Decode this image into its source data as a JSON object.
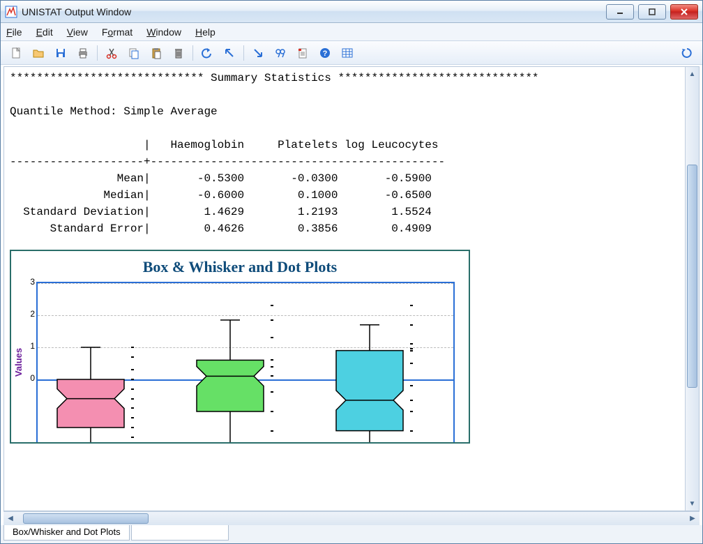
{
  "title": "UNISTAT Output Window",
  "menus": {
    "file": "File",
    "edit": "Edit",
    "view": "View",
    "format": "Format",
    "window": "Window",
    "help": "Help"
  },
  "toolbar_icons": [
    "new-file",
    "open-file",
    "save-file",
    "print",
    "cut",
    "copy",
    "paste",
    "delete",
    "undo",
    "nw-arrow",
    "se-arrow",
    "find",
    "properties",
    "help",
    "table",
    "refresh"
  ],
  "output": {
    "banner_left": "*****************************",
    "banner_title": " Summary Statistics ",
    "banner_right": "******************************",
    "quantile_line": "Quantile Method: Simple Average",
    "header_pipe": "                    |   Haemoglobin     Platelets log Leucocytes",
    "rule": "--------------------+--------------------------------------------",
    "rows": {
      "mean": "                Mean|       -0.5300       -0.0300       -0.5900",
      "median": "              Median|       -0.6000        0.1000       -0.6500",
      "sd": "  Standard Deviation|        1.4629        1.2193        1.5524",
      "se": "      Standard Error|        0.4626        0.3856        0.4909"
    }
  },
  "chart_data": {
    "type": "box",
    "title": "Box & Whisker and Dot Plots",
    "ylabel": "Values",
    "ylim": [
      -2,
      3
    ],
    "yticks": [
      0,
      1,
      2,
      3
    ],
    "series": [
      {
        "name": "Haemoglobin",
        "color": "#f48fb1",
        "q1": -1.5,
        "median": -0.6,
        "q3": 0.0,
        "whisker_low": -2.0,
        "whisker_high": 1.0,
        "dots": [
          -1.8,
          -1.5,
          -1.2,
          -0.9,
          -0.6,
          -0.3,
          0.0,
          0.3,
          0.7,
          1.0
        ]
      },
      {
        "name": "Platelets",
        "color": "#66e066",
        "q1": -1.0,
        "median": 0.1,
        "q3": 0.6,
        "whisker_low": -2.0,
        "whisker_high": 1.85,
        "dots": [
          -1.6,
          -1.0,
          -0.4,
          0.1,
          0.1,
          0.4,
          0.6,
          1.3,
          1.85,
          2.3
        ]
      },
      {
        "name": "log Leucocytes",
        "color": "#4dd0e1",
        "q1": -1.6,
        "median": -0.65,
        "q3": 0.9,
        "whisker_low": -2.0,
        "whisker_high": 1.7,
        "dots": [
          -1.6,
          -1.0,
          -0.65,
          -0.2,
          0.5,
          0.9,
          0.95,
          1.1,
          1.7,
          2.3
        ]
      }
    ]
  },
  "tabs": {
    "active": "Box/Whisker and Dot Plots"
  },
  "colors": {
    "accent": "#2a6fd6",
    "chart_border": "#2a6e6a",
    "title_text": "#0f4c7a",
    "ylabel": "#6a1b9a"
  }
}
